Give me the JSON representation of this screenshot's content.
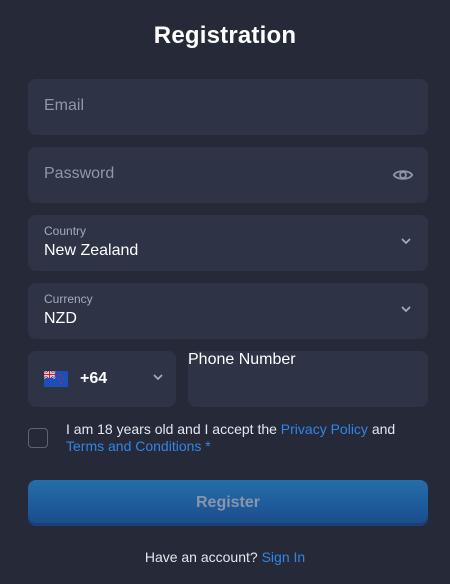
{
  "title": "Registration",
  "email": {
    "placeholder": "Email"
  },
  "password": {
    "placeholder": "Password",
    "icon": "eye-icon"
  },
  "country": {
    "label": "Country",
    "value": "New Zealand"
  },
  "currency": {
    "label": "Currency",
    "value": "NZD"
  },
  "phone": {
    "code": "+64",
    "placeholder": "Phone Number",
    "flag": "New Zealand"
  },
  "terms": {
    "text": "I am 18 years old and I accept the",
    "privacy": "Privacy Policy",
    "and": "and",
    "conditions": "Terms and Conditions",
    "required_mark": "*"
  },
  "register_label": "Register",
  "signin": {
    "prompt": "Have an account?",
    "link": "Sign In"
  },
  "colors": {
    "background": "#262a38",
    "field": "#2e3345",
    "link": "#2f86e8",
    "button": "#1e5b9a"
  }
}
